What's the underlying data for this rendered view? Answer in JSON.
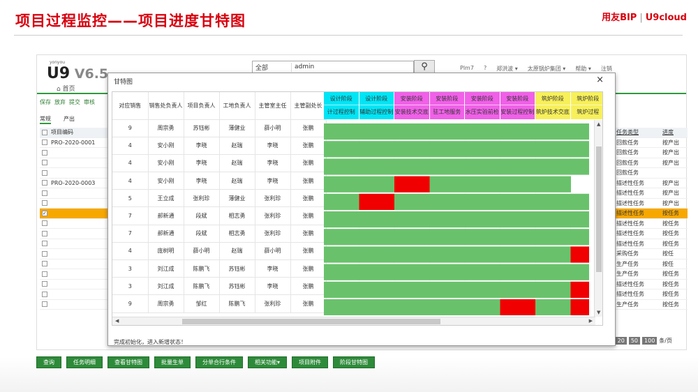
{
  "slide": {
    "title": "项目过程监控——项目进度甘特图",
    "brand_left": "用友BIP",
    "brand_sep": "|",
    "brand_right": "U9cloud"
  },
  "app": {
    "logo_small": "yonyou",
    "logo_main": "U9",
    "logo_ver": " V6.5",
    "search_scope": "全部",
    "search_value": "admin",
    "search_icon": "search-icon",
    "top_links": [
      "Plm7",
      "?",
      "郑洪波 ▾",
      "太原锅炉集团 ▾",
      "帮助 ▾",
      "注销"
    ],
    "home_label": "首页",
    "toolbar": [
      "保存",
      "放弃",
      "提交",
      "审核"
    ],
    "tabs": [
      "常规",
      "产出"
    ],
    "left_grid_header": "项目编码",
    "left_grid_rows": [
      "PRO-2020-0001",
      "",
      "",
      "",
      "PRO-2020-0003",
      "",
      "",
      "",
      "",
      "",
      "",
      "",
      "",
      "",
      "",
      "",
      ""
    ],
    "right_grid_header": [
      "任务类型",
      "进度"
    ],
    "right_grid_rows": [
      [
        "回款任务",
        "按产出"
      ],
      [
        "回款任务",
        "按产出"
      ],
      [
        "回款任务",
        "按产出"
      ],
      [
        "回款任务",
        ""
      ],
      [
        "描述性任务",
        "按产出"
      ],
      [
        "描述性任务",
        "按产出"
      ],
      [
        "描述性任务",
        "按产出"
      ],
      [
        "描述性任务",
        "按任务"
      ],
      [
        "描述性任务",
        "按任务"
      ],
      [
        "描述性任务",
        "按任务"
      ],
      [
        "描述性任务",
        "按任务"
      ],
      [
        "采购任务",
        "按任"
      ],
      [
        "生产任务",
        "按任"
      ],
      [
        "生产任务",
        "按任务"
      ],
      [
        "描述性任务",
        "按任务"
      ],
      [
        "描述性任务",
        "按任务"
      ],
      [
        "生产任务",
        "按任务"
      ]
    ],
    "pager": [
      "20",
      "50",
      "100",
      "条/页"
    ],
    "bottom_buttons": [
      "查询",
      "任务明细",
      "查看甘特图",
      "批量生单",
      "分单合行条件",
      "相关功能▾",
      "项目附件",
      "阶段甘特图"
    ]
  },
  "dialog": {
    "title": "甘特图",
    "close": "×",
    "status": "完成初始化，进入新增状态！",
    "columns": [
      "对应销售",
      "销售处负责人",
      "项目负责人",
      "工地负责人",
      "主管室主任",
      "主管副处长"
    ],
    "stages": [
      {
        "top": "设计阶段",
        "bottom": "计过程控制",
        "color": "#00e5f5"
      },
      {
        "top": "设计阶段",
        "bottom": "辅助过程控制",
        "color": "#00e5f5"
      },
      {
        "top": "安装阶段",
        "bottom": "安装技术交底",
        "color": "#f060e8"
      },
      {
        "top": "安装阶段",
        "bottom": "驻工地服务",
        "color": "#f060e8"
      },
      {
        "top": "安装阶段",
        "bottom": "水压实验前检",
        "color": "#f060e8"
      },
      {
        "top": "安装阶段",
        "bottom": "安装过程控制",
        "color": "#f060e8"
      },
      {
        "top": "筑炉阶段",
        "bottom": "筑炉技术交底",
        "color": "#f7f05a"
      },
      {
        "top": "筑炉阶段",
        "bottom": "筑炉过程",
        "color": "#f7f05a"
      }
    ],
    "rows": [
      [
        "9",
        "周宗勇",
        "苏钰彬",
        "薄健业",
        "薛小明",
        "张鹏"
      ],
      [
        "4",
        "安小刚",
        "李晓",
        "赵瑞",
        "李晓",
        "张鹏"
      ],
      [
        "4",
        "安小刚",
        "李晓",
        "赵瑞",
        "李晓",
        "张鹏"
      ],
      [
        "4",
        "安小刚",
        "李晓",
        "赵瑞",
        "李晓",
        "张鹏"
      ],
      [
        "5",
        "王立成",
        "张利珍",
        "薄健业",
        "张利珍",
        "张鹏"
      ],
      [
        "7",
        "郝新通",
        "段斌",
        "相志勇",
        "张利珍",
        "张鹏"
      ],
      [
        "7",
        "郝新通",
        "段斌",
        "相志勇",
        "张利珍",
        "张鹏"
      ],
      [
        "4",
        "庞树明",
        "薛小明",
        "赵瑞",
        "薛小明",
        "张鹏"
      ],
      [
        "3",
        "刘江成",
        "陈鹏飞",
        "苏钰彬",
        "李晓",
        "张鹏"
      ],
      [
        "3",
        "刘江成",
        "陈鹏飞",
        "苏钰彬",
        "李晓",
        "张鹏"
      ],
      [
        "9",
        "周宗勇",
        "邹红",
        "陈鹏飞",
        "张利珍",
        "张鹏"
      ]
    ],
    "colors": {
      "green": "#69c26b",
      "red": "#f00000"
    },
    "gantt_cells": [
      [
        "g",
        "g",
        "g",
        "g",
        "g",
        "g",
        "g",
        "g"
      ],
      [
        "g",
        "g",
        "g",
        "g",
        "g",
        "g",
        "g",
        "g"
      ],
      [
        "g",
        "g",
        "g",
        "g",
        "g",
        "g",
        "g",
        "g"
      ],
      [
        "g",
        "g",
        "r",
        "g",
        "g",
        "g",
        "g",
        "e"
      ],
      [
        "g",
        "r",
        "g",
        "g",
        "g",
        "g",
        "g",
        "g"
      ],
      [
        "g",
        "g",
        "g",
        "g",
        "g",
        "g",
        "g",
        "g"
      ],
      [
        "g",
        "g",
        "g",
        "g",
        "g",
        "g",
        "g",
        "g"
      ],
      [
        "g",
        "g",
        "g",
        "g",
        "g",
        "g",
        "g",
        "r"
      ],
      [
        "g",
        "g",
        "g",
        "g",
        "g",
        "g",
        "g",
        "g"
      ],
      [
        "g",
        "g",
        "g",
        "g",
        "g",
        "g",
        "g",
        "r"
      ],
      [
        "g",
        "g",
        "g",
        "g",
        "g",
        "r",
        "g",
        "r"
      ]
    ]
  }
}
